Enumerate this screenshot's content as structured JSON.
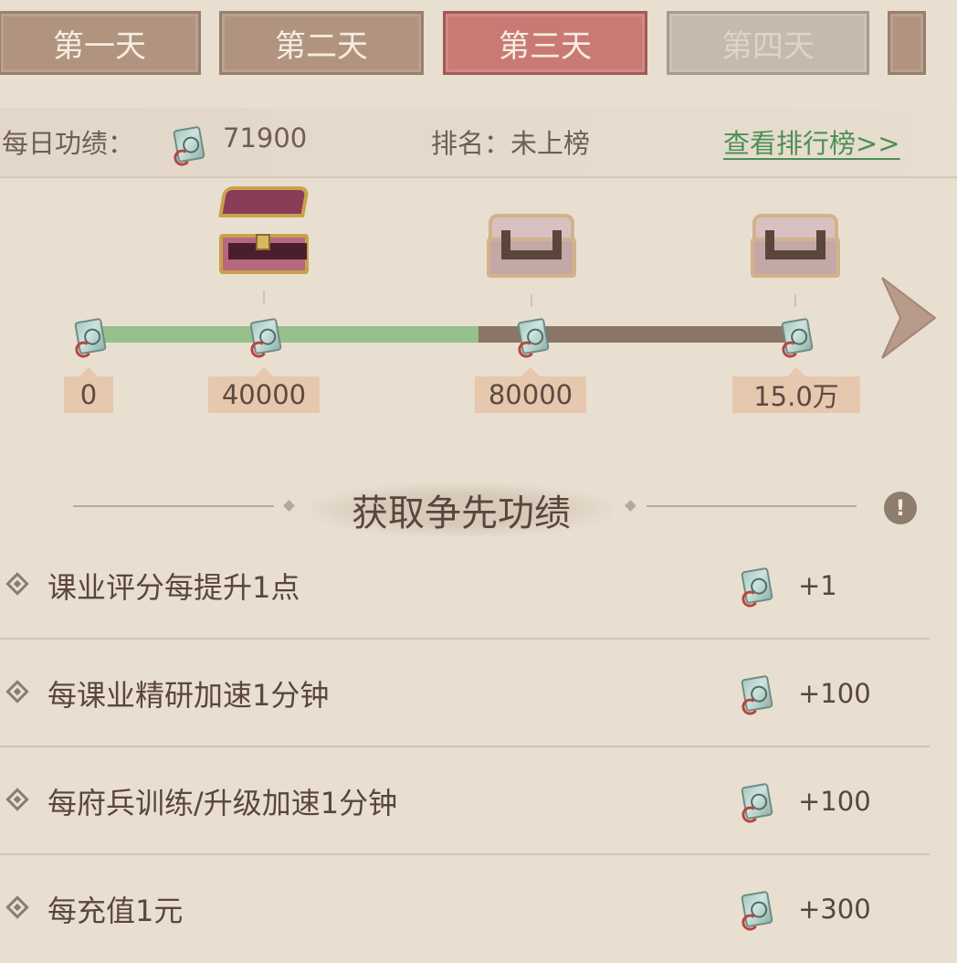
{
  "tabs": [
    {
      "label": "第一天",
      "state": "normal"
    },
    {
      "label": "第二天",
      "state": "normal"
    },
    {
      "label": "第三天",
      "state": "active"
    },
    {
      "label": "第四天",
      "state": "locked"
    }
  ],
  "stats": {
    "daily_label": "每日功绩：",
    "daily_value": "71900",
    "rank_label": "排名：未上榜",
    "leaderboard_link": "查看排行榜>>"
  },
  "progress": {
    "current": 71900,
    "max": 150000,
    "milestones": [
      "0",
      "40000",
      "80000",
      "15.0万"
    ],
    "milestone_values": [
      0,
      40000,
      80000,
      150000
    ],
    "chest_states": [
      "opened",
      "locked",
      "locked"
    ]
  },
  "section": {
    "title": "获取争先功绩"
  },
  "rules": [
    {
      "text": "课业评分每提升1点",
      "value": "+1"
    },
    {
      "text": "每课业精研加速1分钟",
      "value": "+100"
    },
    {
      "text": "每府兵训练/升级加速1分钟",
      "value": "+100"
    },
    {
      "text": "每充值1元",
      "value": "+300"
    }
  ],
  "colors": {
    "active_tab": "#c97a74",
    "progress_fill": "#97c08f",
    "link": "#4d8f57"
  }
}
